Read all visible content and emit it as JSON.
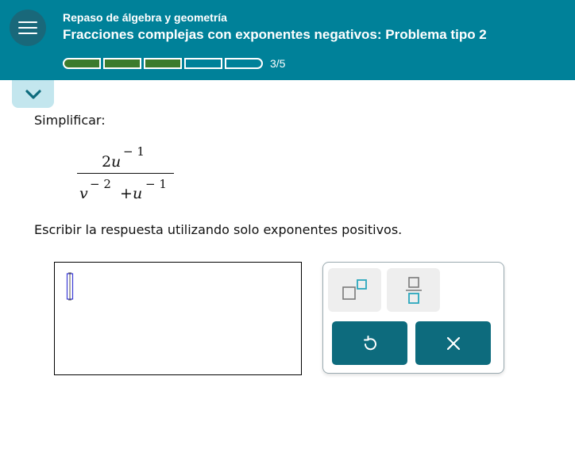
{
  "header": {
    "topic": "Repaso de álgebra y geometría",
    "title": "Fracciones complejas con exponentes negativos: Problema tipo 2",
    "progress_text": "3/5",
    "progress": {
      "completed": 3,
      "total": 5
    }
  },
  "icons": {
    "menu": "menu-icon",
    "collapse": "chevron-down-icon",
    "exponent": "exponent-template-icon",
    "fraction": "fraction-template-icon",
    "undo": "undo-icon",
    "clear": "close-icon"
  },
  "problem": {
    "instruction": "Simplificar:",
    "expression": {
      "numerator": {
        "coefficient": "2",
        "base": "u",
        "exponent": "− 1"
      },
      "denominator": [
        {
          "base": "v",
          "exponent": "− 2"
        },
        {
          "operator": "+",
          "base": "u",
          "exponent": "− 1"
        }
      ]
    },
    "instruction2": "Escribir la respuesta utilizando solo exponentes positivos."
  },
  "colors": {
    "header_bg": "#008199",
    "progress_filled": "#3c7b2d",
    "collapse_tab": "#c3e6ee",
    "action_button": "#0d6b7d",
    "template_icon": "#2aa7bd",
    "cursor": "#3b3bd6"
  }
}
